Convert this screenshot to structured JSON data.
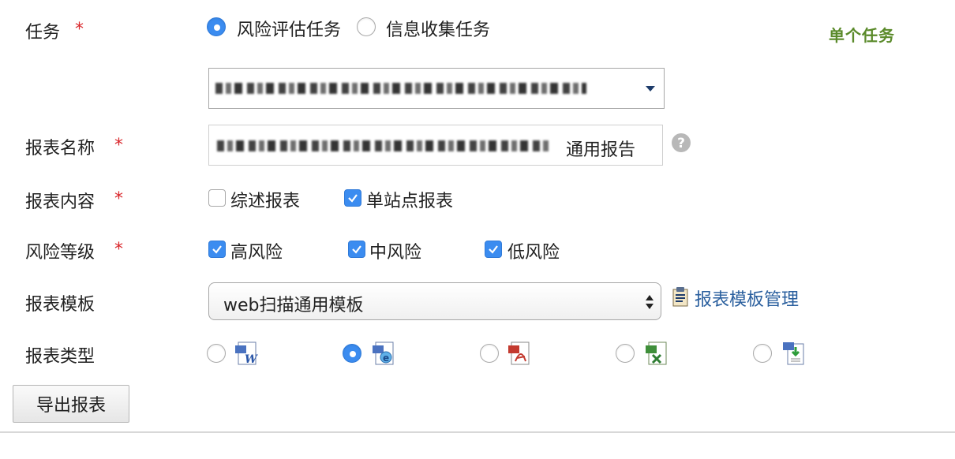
{
  "header": {
    "mode_label": "单个任务"
  },
  "task": {
    "label": "任务",
    "options": [
      "风险评估任务",
      "信息收集任务"
    ],
    "selected": "风险评估任务"
  },
  "report_name": {
    "label": "报表名称",
    "suffix": "通用报告"
  },
  "report_content": {
    "label": "报表内容",
    "options": [
      {
        "label": "综述报表",
        "checked": false
      },
      {
        "label": "单站点报表",
        "checked": true
      }
    ]
  },
  "risk_level": {
    "label": "风险等级",
    "options": [
      {
        "label": "高风险",
        "checked": true
      },
      {
        "label": "中风险",
        "checked": true
      },
      {
        "label": "低风险",
        "checked": true
      }
    ]
  },
  "template": {
    "label": "报表模板",
    "selected": "web扫描通用模板",
    "manage_link": "报表模板管理"
  },
  "report_type": {
    "label": "报表类型",
    "options": [
      {
        "icon": "word-doc-icon",
        "selected": false
      },
      {
        "icon": "html-doc-icon",
        "selected": true
      },
      {
        "icon": "pdf-doc-icon",
        "selected": false
      },
      {
        "icon": "excel-doc-icon",
        "selected": false
      },
      {
        "icon": "xml-doc-icon",
        "selected": false
      }
    ]
  },
  "actions": {
    "export_label": "导出报表"
  },
  "colors": {
    "accent": "#3b8cf0",
    "required": "#d9262b",
    "link": "#2a5f9e",
    "mode_label": "#5a8a2a"
  }
}
